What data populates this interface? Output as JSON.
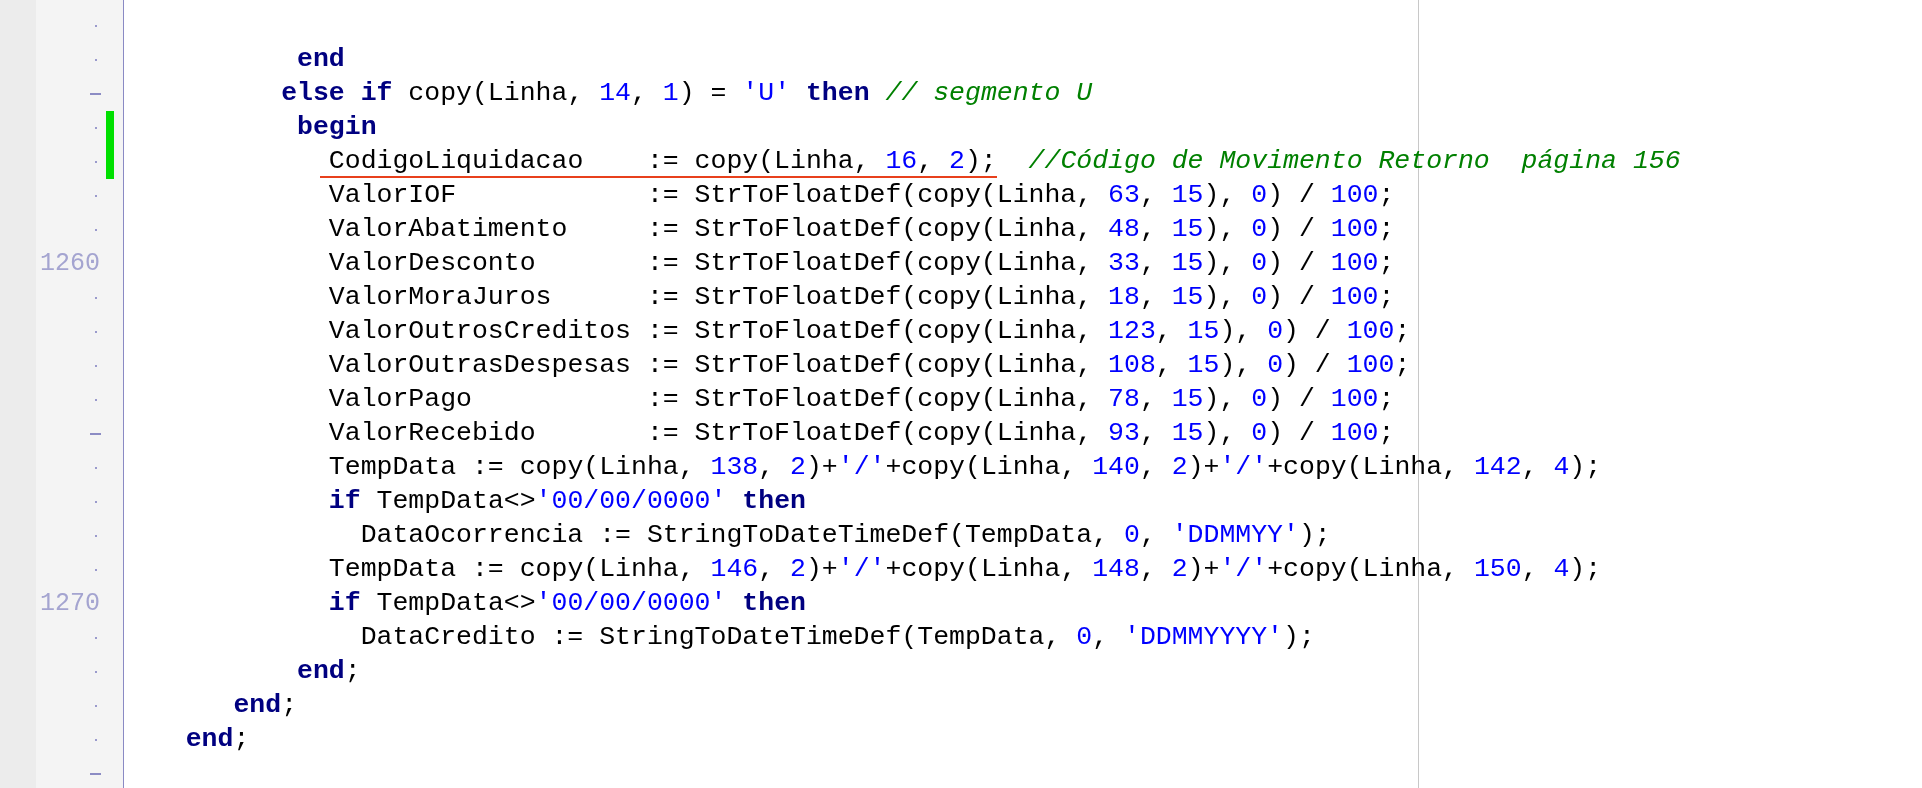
{
  "editor": {
    "rows": [
      {
        "gutter": {
          "kind": "dot"
        },
        "modified": false,
        "underlined": false,
        "segments": []
      },
      {
        "gutter": {
          "kind": "dot"
        },
        "modified": false,
        "underlined": false,
        "segments": [
          {
            "kind": "keyword",
            "text": "          end"
          }
        ]
      },
      {
        "gutter": {
          "kind": "fold"
        },
        "modified": false,
        "underlined": false,
        "segments": [
          {
            "kind": "keyword",
            "text": "         else if"
          },
          {
            "kind": "plain",
            "text": " copy(Linha, "
          },
          {
            "kind": "number",
            "text": "14"
          },
          {
            "kind": "plain",
            "text": ", "
          },
          {
            "kind": "number",
            "text": "1"
          },
          {
            "kind": "plain",
            "text": ") = "
          },
          {
            "kind": "string",
            "text": "'U' "
          },
          {
            "kind": "keyword",
            "text": "then "
          },
          {
            "kind": "comment",
            "text": "// segmento U"
          }
        ]
      },
      {
        "gutter": {
          "kind": "dot"
        },
        "modified": true,
        "underlined": false,
        "segments": [
          {
            "kind": "keyword",
            "text": "          begin"
          }
        ]
      },
      {
        "gutter": {
          "kind": "dot"
        },
        "modified": true,
        "underlined": true,
        "segments": [
          {
            "kind": "plain",
            "text": "            CodigoLiquidacao    := copy(Linha, "
          },
          {
            "kind": "number",
            "text": "16"
          },
          {
            "kind": "plain",
            "text": ", "
          },
          {
            "kind": "number",
            "text": "2"
          },
          {
            "kind": "plain",
            "text": ");"
          },
          {
            "kind": "comment",
            "text": "  //Código de Movimento Retorno  página 156"
          }
        ]
      },
      {
        "gutter": {
          "kind": "dot"
        },
        "modified": false,
        "underlined": false,
        "segments": [
          {
            "kind": "plain",
            "text": "            ValorIOF            := StrToFloatDef(copy(Linha, "
          },
          {
            "kind": "number",
            "text": "63"
          },
          {
            "kind": "plain",
            "text": ", "
          },
          {
            "kind": "number",
            "text": "15"
          },
          {
            "kind": "plain",
            "text": "), "
          },
          {
            "kind": "number",
            "text": "0"
          },
          {
            "kind": "plain",
            "text": ") / "
          },
          {
            "kind": "number",
            "text": "100"
          },
          {
            "kind": "plain",
            "text": ";"
          }
        ]
      },
      {
        "gutter": {
          "kind": "dot"
        },
        "modified": false,
        "underlined": false,
        "segments": [
          {
            "kind": "plain",
            "text": "            ValorAbatimento     := StrToFloatDef(copy(Linha, "
          },
          {
            "kind": "number",
            "text": "48"
          },
          {
            "kind": "plain",
            "text": ", "
          },
          {
            "kind": "number",
            "text": "15"
          },
          {
            "kind": "plain",
            "text": "), "
          },
          {
            "kind": "number",
            "text": "0"
          },
          {
            "kind": "plain",
            "text": ") / "
          },
          {
            "kind": "number",
            "text": "100"
          },
          {
            "kind": "plain",
            "text": ";"
          }
        ]
      },
      {
        "gutter": {
          "kind": "number",
          "text": "1260"
        },
        "modified": false,
        "underlined": false,
        "segments": [
          {
            "kind": "plain",
            "text": "            ValorDesconto       := StrToFloatDef(copy(Linha, "
          },
          {
            "kind": "number",
            "text": "33"
          },
          {
            "kind": "plain",
            "text": ", "
          },
          {
            "kind": "number",
            "text": "15"
          },
          {
            "kind": "plain",
            "text": "), "
          },
          {
            "kind": "number",
            "text": "0"
          },
          {
            "kind": "plain",
            "text": ") / "
          },
          {
            "kind": "number",
            "text": "100"
          },
          {
            "kind": "plain",
            "text": ";"
          }
        ]
      },
      {
        "gutter": {
          "kind": "dot"
        },
        "modified": false,
        "underlined": false,
        "segments": [
          {
            "kind": "plain",
            "text": "            ValorMoraJuros      := StrToFloatDef(copy(Linha, "
          },
          {
            "kind": "number",
            "text": "18"
          },
          {
            "kind": "plain",
            "text": ", "
          },
          {
            "kind": "number",
            "text": "15"
          },
          {
            "kind": "plain",
            "text": "), "
          },
          {
            "kind": "number",
            "text": "0"
          },
          {
            "kind": "plain",
            "text": ") / "
          },
          {
            "kind": "number",
            "text": "100"
          },
          {
            "kind": "plain",
            "text": ";"
          }
        ]
      },
      {
        "gutter": {
          "kind": "dot"
        },
        "modified": false,
        "underlined": false,
        "segments": [
          {
            "kind": "plain",
            "text": "            ValorOutrosCreditos := StrToFloatDef(copy(Linha, "
          },
          {
            "kind": "number",
            "text": "123"
          },
          {
            "kind": "plain",
            "text": ", "
          },
          {
            "kind": "number",
            "text": "15"
          },
          {
            "kind": "plain",
            "text": "), "
          },
          {
            "kind": "number",
            "text": "0"
          },
          {
            "kind": "plain",
            "text": ") / "
          },
          {
            "kind": "number",
            "text": "100"
          },
          {
            "kind": "plain",
            "text": ";"
          }
        ]
      },
      {
        "gutter": {
          "kind": "dot"
        },
        "modified": false,
        "underlined": false,
        "segments": [
          {
            "kind": "plain",
            "text": "            ValorOutrasDespesas := StrToFloatDef(copy(Linha, "
          },
          {
            "kind": "number",
            "text": "108"
          },
          {
            "kind": "plain",
            "text": ", "
          },
          {
            "kind": "number",
            "text": "15"
          },
          {
            "kind": "plain",
            "text": "), "
          },
          {
            "kind": "number",
            "text": "0"
          },
          {
            "kind": "plain",
            "text": ") / "
          },
          {
            "kind": "number",
            "text": "100"
          },
          {
            "kind": "plain",
            "text": ";"
          }
        ]
      },
      {
        "gutter": {
          "kind": "dot"
        },
        "modified": false,
        "underlined": false,
        "segments": [
          {
            "kind": "plain",
            "text": "            ValorPago           := StrToFloatDef(copy(Linha, "
          },
          {
            "kind": "number",
            "text": "78"
          },
          {
            "kind": "plain",
            "text": ", "
          },
          {
            "kind": "number",
            "text": "15"
          },
          {
            "kind": "plain",
            "text": "), "
          },
          {
            "kind": "number",
            "text": "0"
          },
          {
            "kind": "plain",
            "text": ") / "
          },
          {
            "kind": "number",
            "text": "100"
          },
          {
            "kind": "plain",
            "text": ";"
          }
        ]
      },
      {
        "gutter": {
          "kind": "fold"
        },
        "modified": false,
        "underlined": false,
        "segments": [
          {
            "kind": "plain",
            "text": "            ValorRecebido       := StrToFloatDef(copy(Linha, "
          },
          {
            "kind": "number",
            "text": "93"
          },
          {
            "kind": "plain",
            "text": ", "
          },
          {
            "kind": "number",
            "text": "15"
          },
          {
            "kind": "plain",
            "text": "), "
          },
          {
            "kind": "number",
            "text": "0"
          },
          {
            "kind": "plain",
            "text": ") / "
          },
          {
            "kind": "number",
            "text": "100"
          },
          {
            "kind": "plain",
            "text": ";"
          }
        ]
      },
      {
        "gutter": {
          "kind": "dot"
        },
        "modified": false,
        "underlined": false,
        "segments": [
          {
            "kind": "plain",
            "text": "            TempData := copy(Linha, "
          },
          {
            "kind": "number",
            "text": "138"
          },
          {
            "kind": "plain",
            "text": ", "
          },
          {
            "kind": "number",
            "text": "2"
          },
          {
            "kind": "plain",
            "text": ")+"
          },
          {
            "kind": "string",
            "text": "'/'"
          },
          {
            "kind": "plain",
            "text": "+copy(Linha, "
          },
          {
            "kind": "number",
            "text": "140"
          },
          {
            "kind": "plain",
            "text": ", "
          },
          {
            "kind": "number",
            "text": "2"
          },
          {
            "kind": "plain",
            "text": ")+"
          },
          {
            "kind": "string",
            "text": "'/'"
          },
          {
            "kind": "plain",
            "text": "+copy(Linha, "
          },
          {
            "kind": "number",
            "text": "142"
          },
          {
            "kind": "plain",
            "text": ", "
          },
          {
            "kind": "number",
            "text": "4"
          },
          {
            "kind": "plain",
            "text": ");"
          }
        ]
      },
      {
        "gutter": {
          "kind": "dot"
        },
        "modified": false,
        "underlined": false,
        "segments": [
          {
            "kind": "keyword",
            "text": "            if"
          },
          {
            "kind": "plain",
            "text": " TempData<>"
          },
          {
            "kind": "string",
            "text": "'00/00/0000' "
          },
          {
            "kind": "keyword",
            "text": "then"
          }
        ]
      },
      {
        "gutter": {
          "kind": "dot"
        },
        "modified": false,
        "underlined": false,
        "segments": [
          {
            "kind": "plain",
            "text": "              DataOcorrencia := StringToDateTimeDef(TempData, "
          },
          {
            "kind": "number",
            "text": "0"
          },
          {
            "kind": "plain",
            "text": ", "
          },
          {
            "kind": "string",
            "text": "'DDMMYY'"
          },
          {
            "kind": "plain",
            "text": ");"
          }
        ]
      },
      {
        "gutter": {
          "kind": "dot"
        },
        "modified": false,
        "underlined": false,
        "segments": [
          {
            "kind": "plain",
            "text": "            TempData := copy(Linha, "
          },
          {
            "kind": "number",
            "text": "146"
          },
          {
            "kind": "plain",
            "text": ", "
          },
          {
            "kind": "number",
            "text": "2"
          },
          {
            "kind": "plain",
            "text": ")+"
          },
          {
            "kind": "string",
            "text": "'/'"
          },
          {
            "kind": "plain",
            "text": "+copy(Linha, "
          },
          {
            "kind": "number",
            "text": "148"
          },
          {
            "kind": "plain",
            "text": ", "
          },
          {
            "kind": "number",
            "text": "2"
          },
          {
            "kind": "plain",
            "text": ")+"
          },
          {
            "kind": "string",
            "text": "'/'"
          },
          {
            "kind": "plain",
            "text": "+copy(Linha, "
          },
          {
            "kind": "number",
            "text": "150"
          },
          {
            "kind": "plain",
            "text": ", "
          },
          {
            "kind": "number",
            "text": "4"
          },
          {
            "kind": "plain",
            "text": ");"
          }
        ]
      },
      {
        "gutter": {
          "kind": "number",
          "text": "1270"
        },
        "modified": false,
        "underlined": false,
        "segments": [
          {
            "kind": "keyword",
            "text": "            if"
          },
          {
            "kind": "plain",
            "text": " TempData<>"
          },
          {
            "kind": "string",
            "text": "'00/00/0000' "
          },
          {
            "kind": "keyword",
            "text": "then"
          }
        ]
      },
      {
        "gutter": {
          "kind": "dot"
        },
        "modified": false,
        "underlined": false,
        "segments": [
          {
            "kind": "plain",
            "text": "              DataCredito := StringToDateTimeDef(TempData, "
          },
          {
            "kind": "number",
            "text": "0"
          },
          {
            "kind": "plain",
            "text": ", "
          },
          {
            "kind": "string",
            "text": "'DDMMYYYY'"
          },
          {
            "kind": "plain",
            "text": ");"
          }
        ]
      },
      {
        "gutter": {
          "kind": "dot"
        },
        "modified": false,
        "underlined": false,
        "segments": [
          {
            "kind": "keyword",
            "text": "          end"
          },
          {
            "kind": "plain",
            "text": ";"
          }
        ]
      },
      {
        "gutter": {
          "kind": "dot"
        },
        "modified": false,
        "underlined": false,
        "segments": [
          {
            "kind": "keyword",
            "text": "      end"
          },
          {
            "kind": "plain",
            "text": ";"
          }
        ]
      },
      {
        "gutter": {
          "kind": "dot"
        },
        "modified": false,
        "underlined": false,
        "segments": [
          {
            "kind": "keyword",
            "text": "   end"
          },
          {
            "kind": "plain",
            "text": ";"
          }
        ]
      },
      {
        "gutter": {
          "kind": "fold"
        },
        "modified": false,
        "underlined": false,
        "segments": []
      }
    ]
  }
}
